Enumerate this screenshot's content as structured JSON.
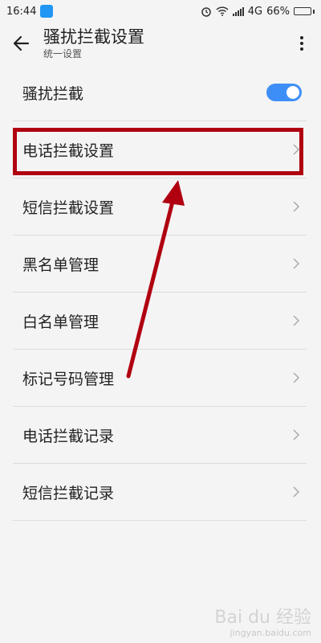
{
  "status_bar": {
    "time": "16:44",
    "network": "4G",
    "battery": "66%",
    "battery_level": 0.66
  },
  "header": {
    "title": "骚扰拦截设置",
    "subtitle": "统一设置"
  },
  "list": {
    "items": [
      {
        "label": "骚扰拦截",
        "toggle_on": true
      },
      {
        "label": "电话拦截设置"
      },
      {
        "label": "短信拦截设置"
      },
      {
        "label": "黑名单管理"
      },
      {
        "label": "白名单管理"
      },
      {
        "label": "标记号码管理"
      },
      {
        "label": "电话拦截记录"
      },
      {
        "label": "短信拦截记录"
      }
    ]
  },
  "colors": {
    "accent": "#3e8ef7",
    "annotation": "#b00010"
  },
  "watermark": {
    "brand": "Bai du 经验",
    "url": "jingyan.baidu.com"
  }
}
